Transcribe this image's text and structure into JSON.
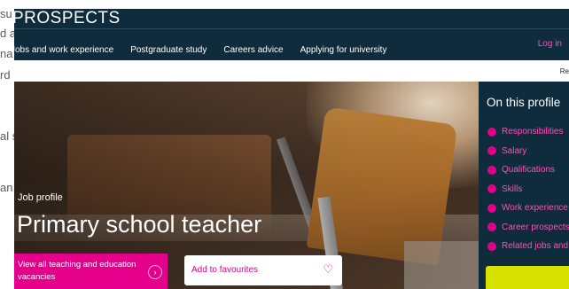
{
  "background_text": {
    "lines": [
      "su",
      "d a",
      "na",
      "rd",
      "al s",
      "an"
    ]
  },
  "header": {
    "logo": "PROSPECTS",
    "nav": [
      "Jobs and work experience",
      "Postgraduate study",
      "Careers advice",
      "Applying for university"
    ],
    "login": "Log in"
  },
  "substrip": {
    "right_text": "Re"
  },
  "hero": {
    "label": "Job profile",
    "title": "Primary school teacher",
    "primary_button": "View all teaching and education vacancies",
    "favourite_button": "Add to favourites"
  },
  "sidebar": {
    "title": "On this profile",
    "items": [
      "Responsibilities",
      "Salary",
      "Qualifications",
      "Skills",
      "Work experience",
      "Career prospects",
      "Related jobs and"
    ]
  },
  "colors": {
    "nav_bg": "#0e2c3c",
    "accent_pink": "#e5008c",
    "cta_yellow": "#d6e100"
  }
}
